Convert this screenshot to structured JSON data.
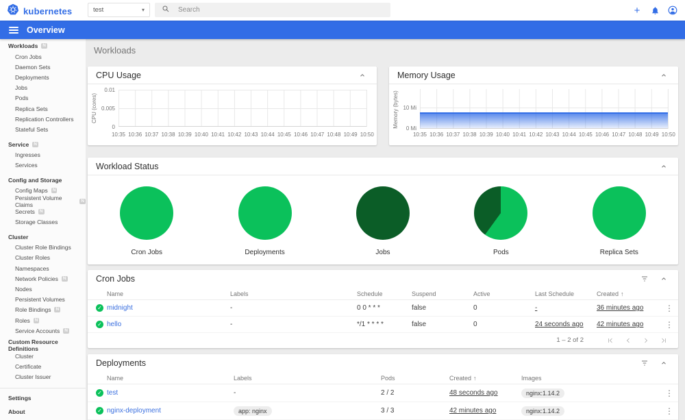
{
  "colors": {
    "primary_blue": "#326de6",
    "link_blue": "#3a6fdf",
    "green": "#0bc15b",
    "dark_green": "#0b5d27"
  },
  "icons": {
    "caret_down": "▾",
    "kebab": "⋮",
    "sort_asc": "↑"
  },
  "topbar": {
    "brand": "kubernetes",
    "namespace": "test",
    "search_placeholder": "Search"
  },
  "appbar": {
    "title": "Overview"
  },
  "sidebar": {
    "sections": [
      {
        "label": "Workloads",
        "badge": "N",
        "items": [
          {
            "label": "Cron Jobs"
          },
          {
            "label": "Daemon Sets"
          },
          {
            "label": "Deployments"
          },
          {
            "label": "Jobs"
          },
          {
            "label": "Pods"
          },
          {
            "label": "Replica Sets"
          },
          {
            "label": "Replication Controllers"
          },
          {
            "label": "Stateful Sets"
          }
        ]
      },
      {
        "label": "Service",
        "badge": "N",
        "items": [
          {
            "label": "Ingresses"
          },
          {
            "label": "Services"
          }
        ]
      },
      {
        "label": "Config and Storage",
        "items": [
          {
            "label": "Config Maps",
            "badge": "N"
          },
          {
            "label": "Persistent Volume Claims",
            "badge": "N"
          },
          {
            "label": "Secrets",
            "badge": "N"
          },
          {
            "label": "Storage Classes"
          }
        ]
      },
      {
        "label": "Cluster",
        "items": [
          {
            "label": "Cluster Role Bindings"
          },
          {
            "label": "Cluster Roles"
          },
          {
            "label": "Namespaces"
          },
          {
            "label": "Network Policies",
            "badge": "N"
          },
          {
            "label": "Nodes"
          },
          {
            "label": "Persistent Volumes"
          },
          {
            "label": "Role Bindings",
            "badge": "N"
          },
          {
            "label": "Roles",
            "badge": "N"
          },
          {
            "label": "Service Accounts",
            "badge": "N"
          }
        ]
      },
      {
        "label": "Custom Resource Definitions",
        "items": [
          {
            "label": "Cluster"
          },
          {
            "label": "Certificate"
          },
          {
            "label": "Cluster Issuer"
          }
        ]
      }
    ],
    "footer_items": [
      {
        "label": "Settings"
      },
      {
        "label": "About"
      }
    ]
  },
  "page": {
    "title": "Workloads"
  },
  "charts": {
    "time_ticks": [
      "10:35",
      "10:36",
      "10:37",
      "10:38",
      "10:39",
      "10:40",
      "10:41",
      "10:42",
      "10:43",
      "10:44",
      "10:45",
      "10:46",
      "10:47",
      "10:48",
      "10:49",
      "10:50"
    ],
    "cpu": {
      "title": "CPU Usage",
      "ylabel": "CPU (cores)",
      "yticks": [
        "0.01",
        "0.005",
        "0"
      ]
    },
    "memory": {
      "title": "Memory Usage",
      "ylabel": "Memory (bytes)",
      "yticks": [
        "10 Mi",
        "0 Mi"
      ]
    }
  },
  "chart_data": [
    {
      "type": "area",
      "title": "CPU Usage",
      "xlabel": "",
      "ylabel": "CPU (cores)",
      "x": [
        "10:35",
        "10:36",
        "10:37",
        "10:38",
        "10:39",
        "10:40",
        "10:41",
        "10:42",
        "10:43",
        "10:44",
        "10:45",
        "10:46",
        "10:47",
        "10:48",
        "10:49",
        "10:50"
      ],
      "values": [],
      "ylim": [
        0,
        0.01
      ],
      "grid": true,
      "note": "no series plotted (empty chart)"
    },
    {
      "type": "area",
      "title": "Memory Usage",
      "xlabel": "",
      "ylabel": "Memory (bytes)",
      "unit": "Mi",
      "x": [
        "10:35",
        "10:36",
        "10:37",
        "10:38",
        "10:39",
        "10:40",
        "10:41",
        "10:42",
        "10:43",
        "10:44",
        "10:45",
        "10:46",
        "10:47",
        "10:48",
        "10:49",
        "10:50"
      ],
      "values": [
        7.4,
        7.4,
        7.4,
        7.4,
        7.4,
        7.4,
        7.4,
        7.4,
        7.4,
        7.4,
        7.4,
        7.4,
        7.4,
        7.4,
        7.4,
        7.4
      ],
      "ylim": [
        0,
        15
      ],
      "grid": true
    }
  ],
  "workload_status": {
    "title": "Workload Status",
    "pies": [
      {
        "label": "Cron Jobs",
        "segments": [
          {
            "color": "#0bc15b",
            "pct": 100
          }
        ]
      },
      {
        "label": "Deployments",
        "segments": [
          {
            "color": "#0bc15b",
            "pct": 100
          }
        ]
      },
      {
        "label": "Jobs",
        "segments": [
          {
            "color": "#0b5d27",
            "pct": 100
          }
        ]
      },
      {
        "label": "Pods",
        "segments": [
          {
            "color": "#0bc15b",
            "pct": 60
          },
          {
            "color": "#0b5d27",
            "pct": 40
          }
        ]
      },
      {
        "label": "Replica Sets",
        "segments": [
          {
            "color": "#0bc15b",
            "pct": 100
          }
        ]
      }
    ]
  },
  "cron_jobs": {
    "title": "Cron Jobs",
    "columns": {
      "name": "Name",
      "labels": "Labels",
      "schedule": "Schedule",
      "suspend": "Suspend",
      "active": "Active",
      "last_schedule": "Last Schedule",
      "created": "Created"
    },
    "sort_column": "Created",
    "rows": [
      {
        "name": "midnight",
        "labels": "-",
        "schedule": "0 0 * * *",
        "suspend": "false",
        "active": "0",
        "last_schedule": "-",
        "created": "36 minutes ago"
      },
      {
        "name": "hello",
        "labels": "-",
        "schedule": "*/1 * * * *",
        "suspend": "false",
        "active": "0",
        "last_schedule": "24 seconds ago",
        "created": "42 minutes ago"
      }
    ],
    "pagination": "1 – 2 of 2"
  },
  "deployments": {
    "title": "Deployments",
    "columns": {
      "name": "Name",
      "labels": "Labels",
      "pods": "Pods",
      "created": "Created",
      "images": "Images"
    },
    "sort_column": "Created",
    "rows": [
      {
        "name": "test",
        "labels": "-",
        "pods": "2 / 2",
        "created": "48 seconds ago",
        "image": "nginx:1.14.2"
      },
      {
        "name": "nginx-deployment",
        "labels": "app: nginx",
        "pods": "3 / 3",
        "created": "42 minutes ago",
        "image": "nginx:1.14.2"
      }
    ]
  }
}
